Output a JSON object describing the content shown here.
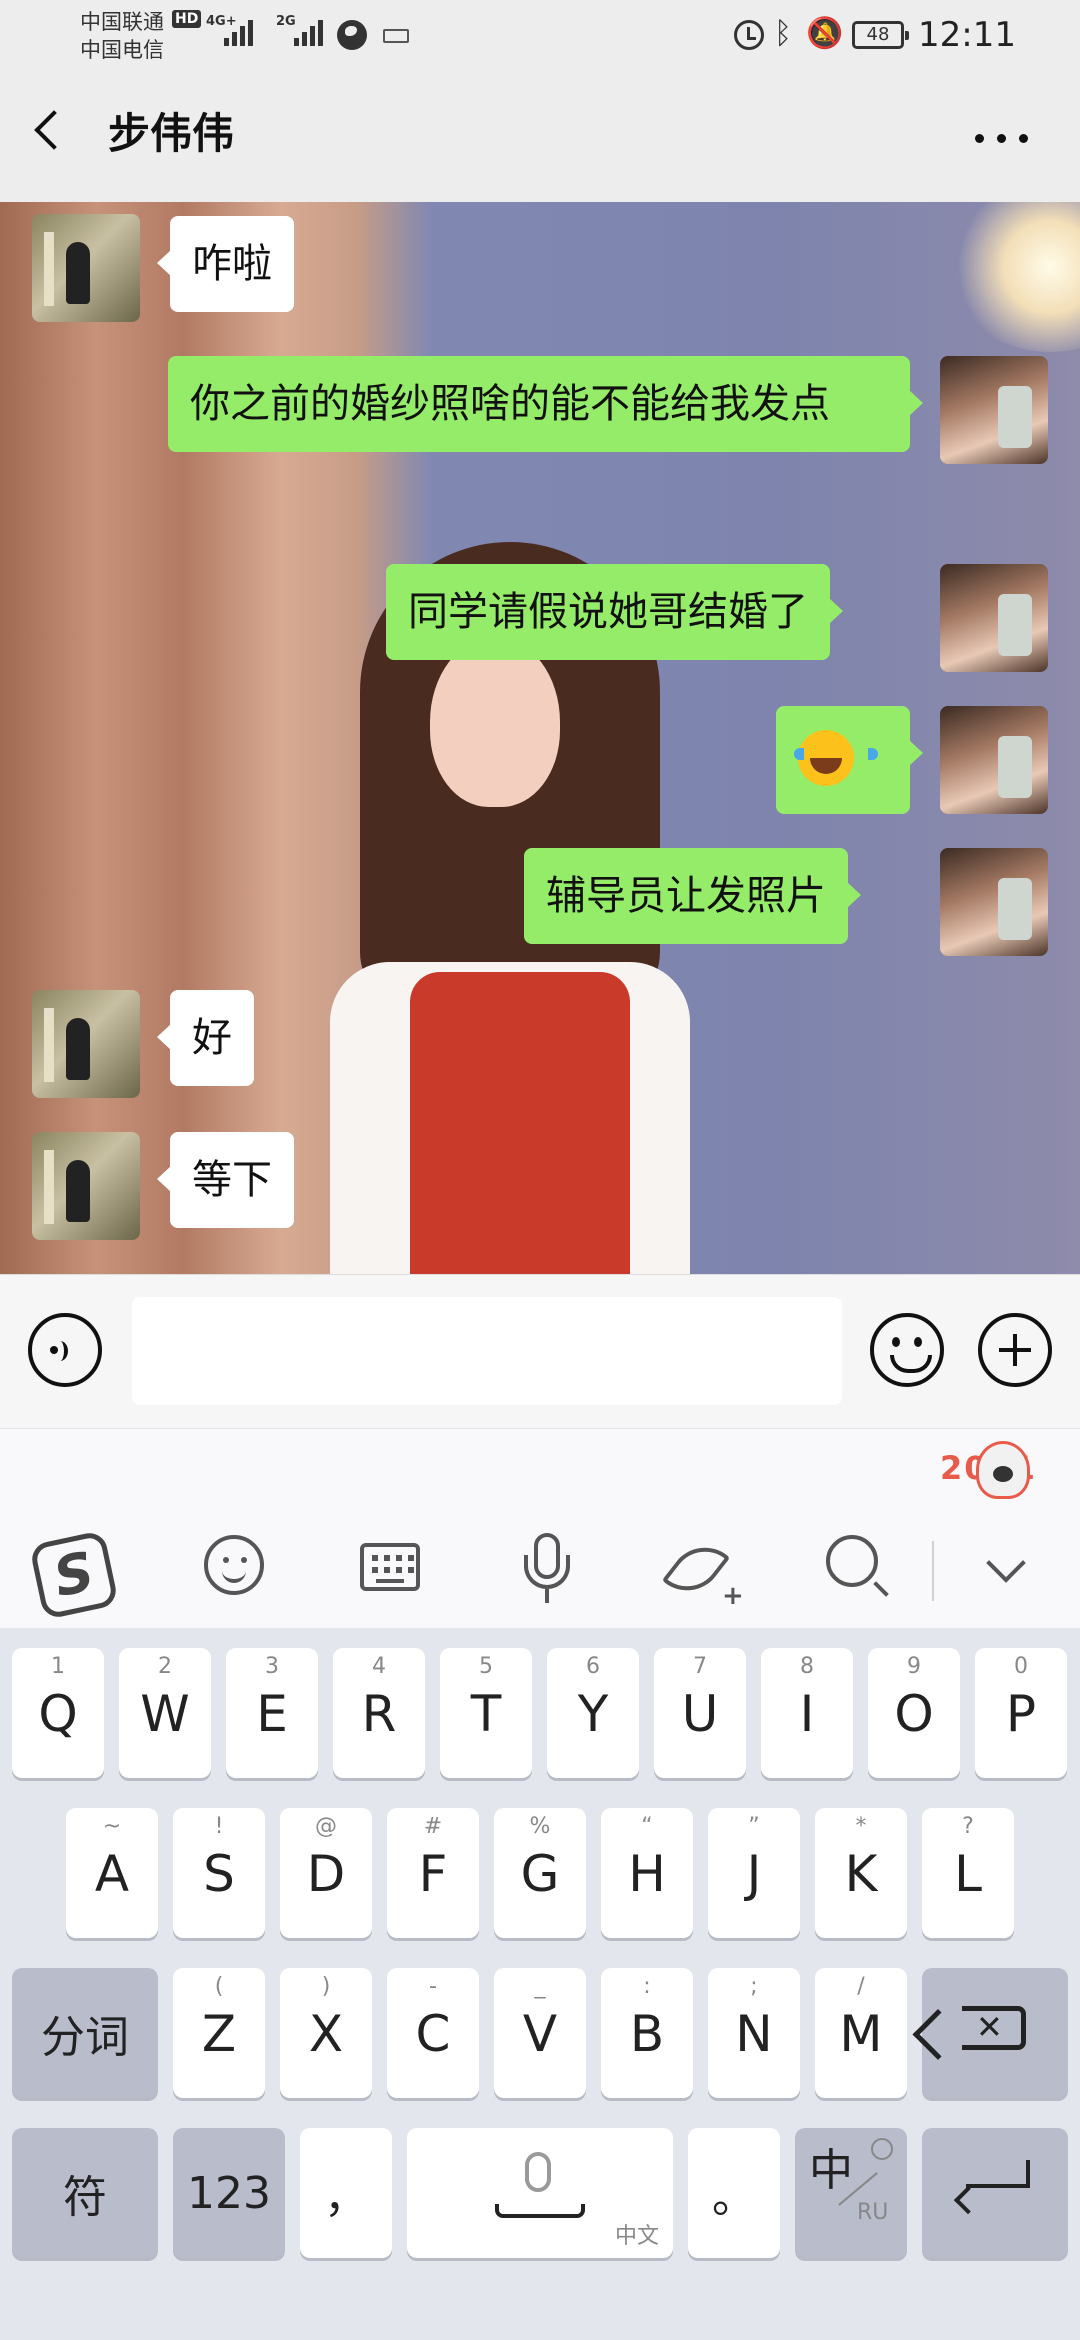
{
  "status_bar": {
    "carrier_1": "中国联通",
    "carrier_2": "中国电信",
    "hd_badge": "HD",
    "network_1": "4G+",
    "network_2": "2G",
    "battery": "48",
    "time": "12:11"
  },
  "header": {
    "title": "步伟伟",
    "back_icon": "back-arrow-icon",
    "more_icon": "more-dots-icon"
  },
  "messages": [
    {
      "side": "left",
      "text": "咋啦"
    },
    {
      "side": "right",
      "text": "你之前的婚纱照啥的能不能给我发点"
    },
    {
      "side": "right",
      "text": "同学请假说她哥结婚了"
    },
    {
      "side": "right",
      "text": "",
      "emoji": "laughing-tears-emoji"
    },
    {
      "side": "right",
      "text": "辅导员让发照片"
    },
    {
      "side": "left",
      "text": "好"
    },
    {
      "side": "left",
      "text": "等下"
    }
  ],
  "input_bar": {
    "value": "",
    "placeholder": ""
  },
  "ime": {
    "banner_text": "2021",
    "tools": [
      "sogou-logo",
      "emoji-icon",
      "keyboard-icon",
      "mic-icon",
      "quill-icon",
      "search-icon",
      "collapse-chevron-icon"
    ],
    "sogou_letter": "S"
  },
  "keyboard": {
    "row1": [
      {
        "sub": "1",
        "main": "Q"
      },
      {
        "sub": "2",
        "main": "W"
      },
      {
        "sub": "3",
        "main": "E"
      },
      {
        "sub": "4",
        "main": "R"
      },
      {
        "sub": "5",
        "main": "T"
      },
      {
        "sub": "6",
        "main": "Y"
      },
      {
        "sub": "7",
        "main": "U"
      },
      {
        "sub": "8",
        "main": "I"
      },
      {
        "sub": "9",
        "main": "O"
      },
      {
        "sub": "0",
        "main": "P"
      }
    ],
    "row2": [
      {
        "sub": "~",
        "main": "A"
      },
      {
        "sub": "!",
        "main": "S"
      },
      {
        "sub": "@",
        "main": "D"
      },
      {
        "sub": "#",
        "main": "F"
      },
      {
        "sub": "%",
        "main": "G"
      },
      {
        "sub": "“",
        "main": "H"
      },
      {
        "sub": "”",
        "main": "J"
      },
      {
        "sub": "*",
        "main": "K"
      },
      {
        "sub": "?",
        "main": "L"
      }
    ],
    "row3": [
      {
        "sub": "(",
        "main": "Z"
      },
      {
        "sub": ")",
        "main": "X"
      },
      {
        "sub": "-",
        "main": "C"
      },
      {
        "sub": "_",
        "main": "V"
      },
      {
        "sub": ":",
        "main": "B"
      },
      {
        "sub": ";",
        "main": "N"
      },
      {
        "sub": "/",
        "main": "M"
      }
    ],
    "fenci_label": "分词",
    "symbol_label": "符",
    "num_label": "123",
    "comma_label": "，",
    "space_label": "中文",
    "period_label": "。",
    "lang_main": "中",
    "lang_sub": "RU"
  }
}
